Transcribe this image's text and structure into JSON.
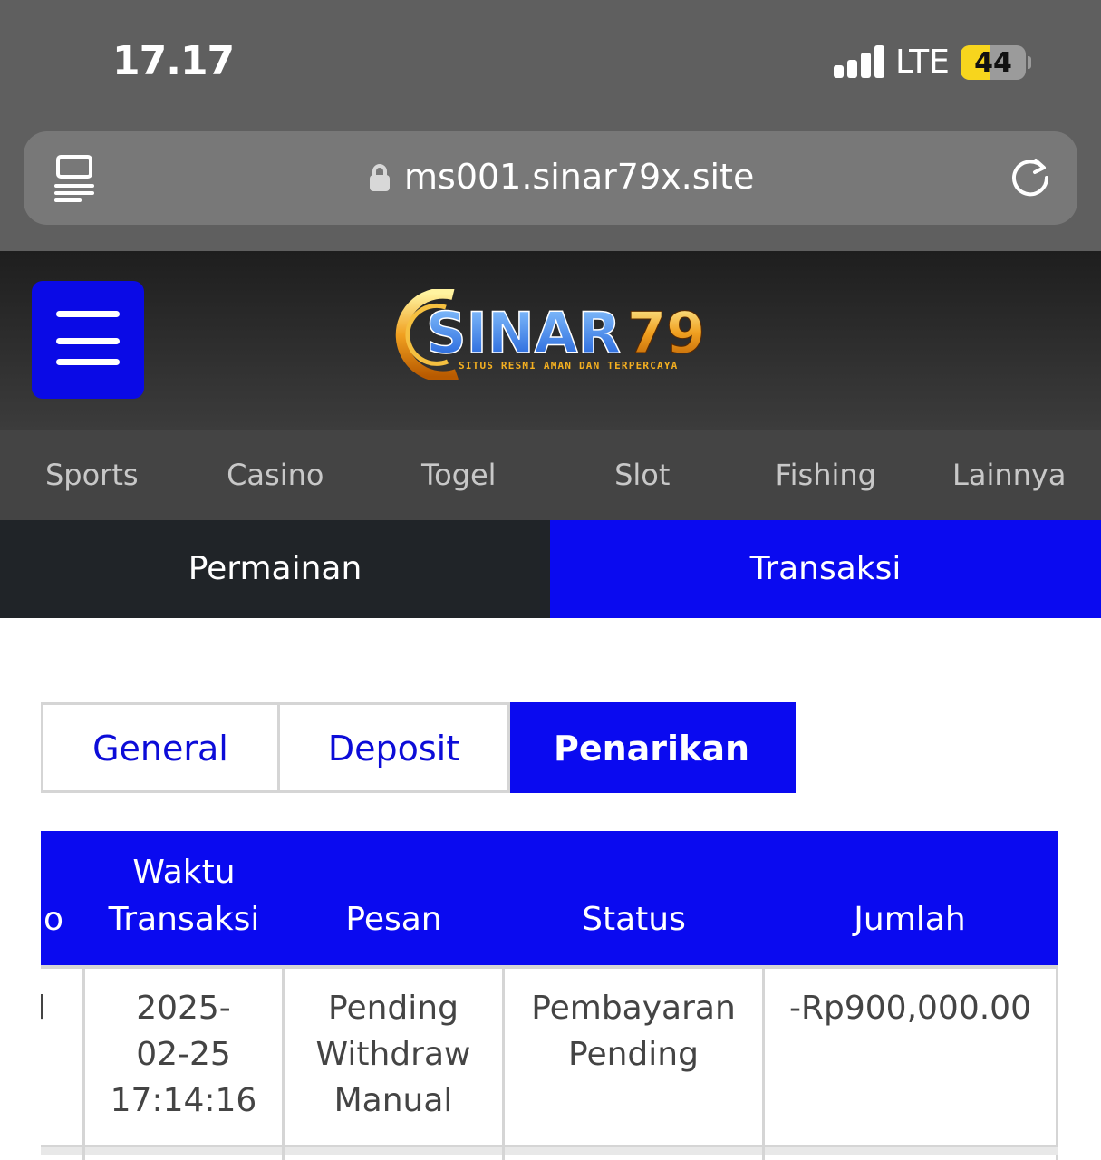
{
  "status_bar": {
    "time": "17.17",
    "network": "LTE",
    "battery": "44",
    "battery_level": 0.44
  },
  "browser": {
    "url": "ms001.sinar79x.site",
    "icons": [
      "reader-mode-icon",
      "lock-icon",
      "reload-icon"
    ]
  },
  "header": {
    "logo_text": "SINAR79",
    "logo_tagline": "SITUS RESMI AMAN DAN TERPERCAYA",
    "menu_icon": "hamburger-menu-icon",
    "button_color": "#0a0ae6"
  },
  "category_nav": [
    "Sports",
    "Casino",
    "Togel",
    "Slot",
    "Fishing",
    "Lainnya"
  ],
  "main_tabs": {
    "permainan": "Permainan",
    "transaksi": "Transaksi",
    "active": "Transaksi"
  },
  "sub_tabs": {
    "general": "General",
    "deposit": "Deposit",
    "penarikan": "Penarikan",
    "active": "Penarikan"
  },
  "table": {
    "headers": {
      "no": "o",
      "waktu_1": "Waktu",
      "waktu_2": "Transaksi",
      "pesan": "Pesan",
      "status": "Status",
      "jumlah": "Jumlah"
    },
    "rows": [
      {
        "no": "l",
        "waktu": [
          "2025-",
          "02-25",
          "17:14:16"
        ],
        "pesan": [
          "Pending",
          "Withdraw",
          "Manual"
        ],
        "status": [
          "Pembayaran",
          "Pending"
        ],
        "jumlah": "-Rp900,000.00"
      }
    ]
  },
  "colors": {
    "accent_blue": "#0a0af0",
    "gray_bar": "#5f5f5f",
    "dark_tab": "#202428"
  }
}
